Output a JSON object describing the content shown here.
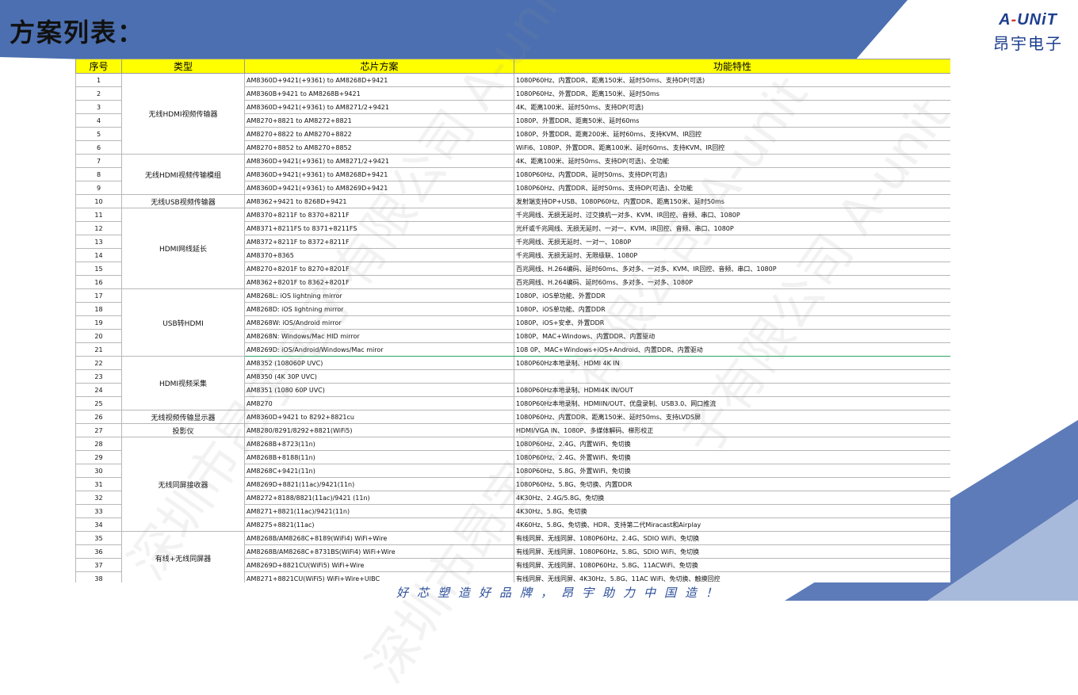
{
  "title": "方案列表：",
  "logo": {
    "en_a": "A",
    "en_dash": "-",
    "en_rest": "UNiT",
    "cn": "昂宇电子"
  },
  "table": {
    "headers": [
      "序号",
      "类型",
      "芯片方案",
      "功能特性"
    ],
    "groups": [
      {
        "type": "无线HDMI视频传输器",
        "rows": [
          [
            "1",
            "AM8360D+9421(+9361) to AM8268D+9421",
            "1080P60Hz、内置DDR、距离150米、延时50ms、支持DP(可选)"
          ],
          [
            "2",
            "AM8360B+9421 to AM8268B+9421",
            "1080P60Hz、外置DDR、距离150米、延时50ms"
          ],
          [
            "3",
            "AM8360D+9421(+9361) to AM8271/2+9421",
            "4K、距离100米、延时50ms、支持DP(可选)"
          ],
          [
            "4",
            "AM8270+8821 to AM8272+8821",
            "1080P、外置DDR、距离50米、延时60ms"
          ],
          [
            "5",
            "AM8270+8822 to AM8270+8822",
            "1080P、外置DDR、距离200米、延时60ms、支持KVM、IR回控"
          ],
          [
            "6",
            "AM8270+8852 to AM8270+8852",
            "WiFi6、1080P、外置DDR、距离100米、延时60ms、支持KVM、IR回控"
          ]
        ]
      },
      {
        "type": "无线HDMI视频传输模组",
        "rows": [
          [
            "7",
            "AM8360D+9421(+9361) to AM8271/2+9421",
            "4K、距离100米、延时50ms、支持DP(可选)、全功能"
          ],
          [
            "8",
            "AM8360D+9421(+9361) to AM8268D+9421",
            "1080P60Hz、内置DDR、延时50ms、支持DP(可选)"
          ],
          [
            "9",
            "AM8360D+9421(+9361) to AM8269D+9421",
            "1080P60Hz、内置DDR、延时50ms、支持DP(可选)、全功能"
          ]
        ]
      },
      {
        "type": "无线USB视频传输器",
        "rows": [
          [
            "10",
            "AM8362+9421 to 8268D+9421",
            "发射端支持DP+USB、1080P60Hz、内置DDR、距离150米、延时50ms"
          ]
        ]
      },
      {
        "type": "HDMI网线延长",
        "rows": [
          [
            "11",
            "AM8370+8211F to 8370+8211F",
            "千兆网线、无损无延时、过交换机一对多、KVM、IR回控、音频、串口、1080P"
          ],
          [
            "12",
            "AM8371+8211FS to 8371+8211FS",
            "光纤或千兆网线、无损无延时、一对一、KVM、IR回控、音频、串口、1080P"
          ],
          [
            "13",
            "AM8372+8211F to 8372+8211F",
            "千兆网线、无损无延时、一对一、1080P"
          ],
          [
            "14",
            "AM8370+8365",
            "千兆网线、无损无延时、无限级联、1080P"
          ],
          [
            "15",
            "AM8270+8201F to 8270+8201F",
            "百兆网线、H.264编码、延时60ms、多对多、一对多、KVM、IR回控、音频、串口、1080P"
          ],
          [
            "16",
            "AM8362+8201F to 8362+8201F",
            "百兆网线、H.264编码、延时60ms、多对多、一对多、1080P"
          ]
        ]
      },
      {
        "type": "USB转HDMI",
        "rows": [
          [
            "17",
            "AM8268L: iOS lightning mirror",
            "1080P、iOS单功能、外置DDR"
          ],
          [
            "18",
            "AM8268D: iOS lightning mirror",
            "1080P、iOS单功能、内置DDR"
          ],
          [
            "19",
            "AM8268W: iOS/Android mirror",
            "1080P、iOS+安卓、外置DDR"
          ],
          [
            "20",
            "AM8268N: Windows/Mac HID mirror",
            "1080P、MAC+Windows、内置DDR、内置驱动"
          ],
          [
            "21",
            "AM8269D: iOS/Android/Windows/Mac miror",
            "108 0P、MAC+Windows+iOS+Android、内置DDR、内置驱动"
          ]
        ]
      },
      {
        "type": "HDMI视频采集",
        "rows": [
          [
            "22",
            "AM8352  (108060P UVC)",
            "1080P60Hz本地录制、HDMI 4K IN"
          ],
          [
            "23",
            "AM8350 (4K 30P UVC)",
            ""
          ],
          [
            "24",
            "AM8351 (1080 60P UVC)",
            "1080P60Hz本地录制、HDMI4K IN/OUT"
          ],
          [
            "25",
            "AM8270",
            "1080P60Hz本地录制、HDMIIN/OUT、优盘录制、USB3.0、网口推流"
          ]
        ]
      },
      {
        "type": "无线视频传输显示器",
        "rows": [
          [
            "26",
            "AM8360D+9421 to 8292+8821cu",
            "1080P60Hz、内置DDR、距离150米、延时50ms、支持LVDS屏"
          ]
        ]
      },
      {
        "type": "投影仪",
        "rows": [
          [
            "27",
            "AM8280/8291/8292+8821(WiFi5)",
            "HDMI/VGA IN、1080P、多媒体解码、梯形校正"
          ]
        ]
      },
      {
        "type": "无线同屏接收器",
        "rows": [
          [
            "28",
            "AM8268B+8723(11n)",
            "1080P60Hz、2.4G、内置WiFi、免切换"
          ],
          [
            "29",
            "AM8268B+8188(11n)",
            "1080P60Hz、2.4G、外置WiFi、免切换"
          ],
          [
            "30",
            "AM8268C+9421(11n)",
            "1080P60Hz、5.8G、外置WiFi、免切换"
          ],
          [
            "31",
            "AM8269D+8821(11ac)/9421(11n)",
            "1080P60Hz、5.8G、免切换、内置DDR"
          ],
          [
            "32",
            "AM8272+8188/8821(11ac)/9421 (11n)",
            "4K30Hz、2.4G/5.8G、免切换"
          ],
          [
            "33",
            "AM8271+8821(11ac)/9421(11n)",
            "4K30Hz、5.8G、免切换"
          ],
          [
            "34",
            "AM8275+8821(11ac)",
            "4K60Hz、5.8G、免切换、HDR、支持第二代Miracast和Airplay"
          ]
        ]
      },
      {
        "type": "有线+无线同屏器",
        "rows": [
          [
            "35",
            "AM8268B/AM8268C+8189(WiFi4) WiFi+Wire",
            "有线同屏、无线同屏、1080P60Hz、2.4G、SDIO WiFi、免切换"
          ],
          [
            "36",
            "AM8268B/AM8268C+8731BS(WiFi4) WiFi+Wire",
            "有线同屏、无线同屏、1080P60Hz、5.8G、SDIO WiFi、免切换"
          ],
          [
            "37",
            "AM8269D+8821CU(WiFi5) WiFi+Wire",
            "有线同屏、无线同屏、1080P60Hz、5.8G、11ACWiFi、免切换"
          ],
          [
            "38",
            "AM8271+8821CU(WiFi5) WiFi+Wire+UIBC",
            "有线同屏、无线同屏、4K30Hz、5.8G、11AC WiFi、免切换、触摸回控"
          ]
        ]
      }
    ]
  },
  "watermarks": [
    "深圳市昂宇电子有限公司 A-unit",
    "深圳市昂宇电子有限公司 A-unit",
    "子有限公司 A-unit"
  ],
  "slogan": "好芯塑造好品牌，昂宇助力中国造！"
}
